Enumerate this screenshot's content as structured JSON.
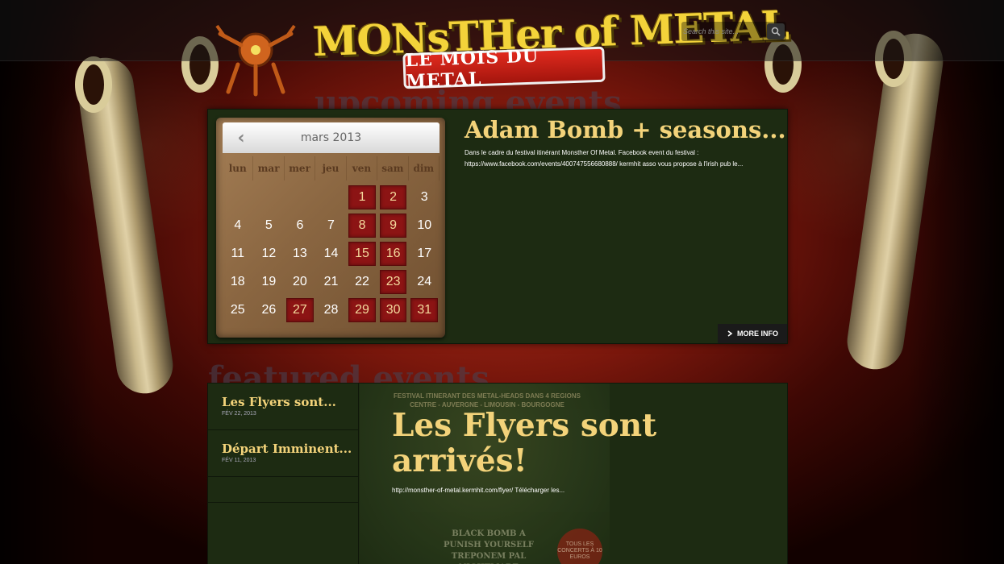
{
  "site": {
    "logo_title": "MONsTHer of METAL",
    "logo_subtitle": "LE MOIS DU METAL"
  },
  "search": {
    "placeholder": "Search this site..."
  },
  "sections": {
    "upcoming_heading": "upcoming events",
    "featured_heading": "featured events"
  },
  "calendar": {
    "month_label": "mars 2013",
    "days_of_week": [
      "lun",
      "mar",
      "mer",
      "jeu",
      "ven",
      "sam",
      "dim"
    ],
    "weeks": [
      [
        null,
        null,
        null,
        null,
        "1",
        "2",
        "3"
      ],
      [
        "4",
        "5",
        "6",
        "7",
        "8",
        "9",
        "10"
      ],
      [
        "11",
        "12",
        "13",
        "14",
        "15",
        "16",
        "17"
      ],
      [
        "18",
        "19",
        "20",
        "21",
        "22",
        "23",
        "24"
      ],
      [
        "25",
        "26",
        "27",
        "28",
        "29",
        "30",
        "31"
      ]
    ],
    "event_days": [
      "1",
      "2",
      "8",
      "9",
      "15",
      "16",
      "23",
      "27",
      "29",
      "30",
      "31"
    ]
  },
  "upcoming_event": {
    "title": "Adam Bomb + seasons...",
    "description": "Dans le cadre du festival itinérant Monsther Of Metal. Facebook event du festival : https://www.facebook.com/events/400747556680888/ kermhit asso vous propose à l'irish pub le...",
    "more_info_label": "MORE INFO"
  },
  "featured": {
    "items": [
      {
        "title": "Les Flyers sont...",
        "date": "FÉV 22, 2013"
      },
      {
        "title": "Départ Imminent...",
        "date": "FÉV 11, 2013"
      }
    ],
    "main_title": "Les Flyers sont arrivés!",
    "main_excerpt": "http://monsther-of-metal.kermhit.com/flyer/ Télécharger les...",
    "flyer_caption": "FESTIVAL ITINERANT DES METAL-HEADS DANS 4 REGIONS CENTRE - AUVERGNE - LIMOUSIN - BOURGOGNE",
    "flyer_bands": "BLACK BOMB A PUNISH YOURSELF TREPONEM PAL NIGHTMARE",
    "flyer_badge": "TOUS LES CONCERTS À 10 EUROS"
  },
  "colors": {
    "panel": "#1d2b12",
    "accent_yellow": "#f3d37a",
    "event_day": "#8c1414"
  }
}
